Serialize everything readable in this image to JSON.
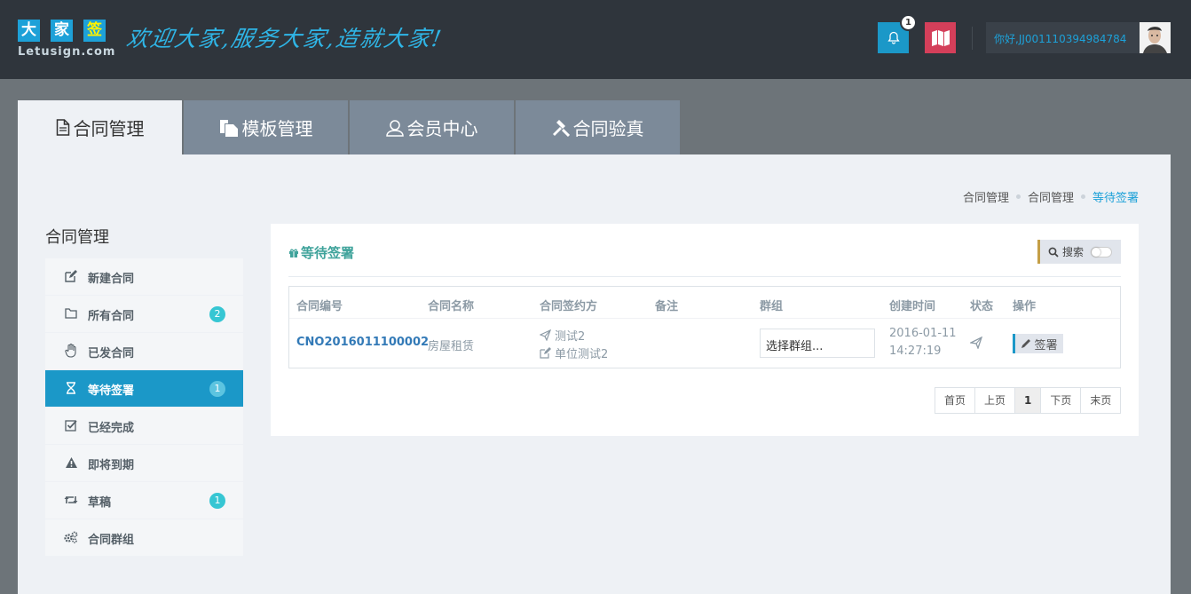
{
  "header": {
    "logo_chars": [
      "大",
      "家",
      "签"
    ],
    "logo_sub": "Letusign.com",
    "slogan": "欢迎大家,服务大家,造就大家!",
    "notification_count": "1",
    "user_greeting": "你好,JJ001110394984784",
    "icons": {
      "bell": "bell-icon",
      "map": "map-icon"
    }
  },
  "tabs": [
    {
      "label": "合同管理",
      "icon": "document-icon",
      "active": true
    },
    {
      "label": "模板管理",
      "icon": "copy-icon",
      "active": false
    },
    {
      "label": "会员中心",
      "icon": "user-icon",
      "active": false
    },
    {
      "label": "合同验真",
      "icon": "gavel-icon",
      "active": false
    }
  ],
  "breadcrumb": [
    "合同管理",
    "合同管理",
    "等待签署"
  ],
  "sidebar": {
    "title": "合同管理",
    "items": [
      {
        "label": "新建合同",
        "icon": "edit-icon",
        "badge": ""
      },
      {
        "label": "所有合同",
        "icon": "folder-icon",
        "badge": "2"
      },
      {
        "label": "已发合同",
        "icon": "hand-icon",
        "badge": ""
      },
      {
        "label": "等待签署",
        "icon": "hourglass-icon",
        "badge": "1",
        "active": true
      },
      {
        "label": "已经完成",
        "icon": "check-square-icon",
        "badge": ""
      },
      {
        "label": "即将到期",
        "icon": "warning-icon",
        "badge": ""
      },
      {
        "label": "草稿",
        "icon": "retweet-icon",
        "badge": "1"
      },
      {
        "label": "合同群组",
        "icon": "cogs-icon",
        "badge": ""
      }
    ]
  },
  "panel": {
    "title": "等待签署",
    "search_label": "搜索",
    "columns": [
      "合同编号",
      "合同名称",
      "合同签约方",
      "备注",
      "群组",
      "创建时间",
      "状态",
      "操作"
    ],
    "rows": [
      {
        "cno": "CNO2016011100002",
        "name": "房屋租赁",
        "party1": "测试2",
        "party2": "单位测试2",
        "note": "",
        "group_placeholder": "选择群组...",
        "date": "2016-01-11",
        "time": "14:27:19",
        "action": "签署"
      }
    ],
    "pager": [
      "首页",
      "上页",
      "1",
      "下页",
      "末页"
    ]
  },
  "colors": {
    "header_bg": "#2f353c",
    "accent_blue": "#1b98c8",
    "map_red": "#d43f5a",
    "teal_title": "#3fa39b",
    "badge_teal": "#36c6d3",
    "tab_inactive": "#7c8a99"
  }
}
